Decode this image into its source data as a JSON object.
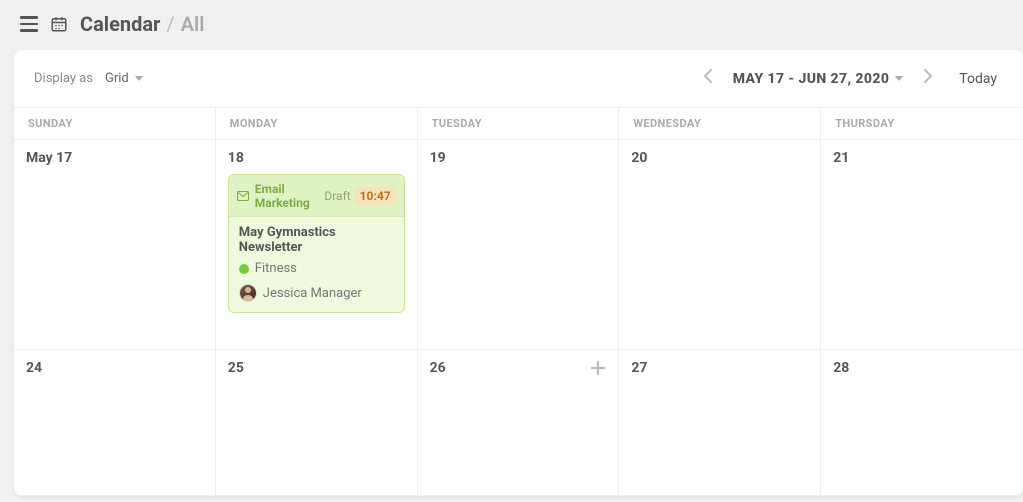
{
  "header": {
    "title": "Calendar",
    "subtitle": "All"
  },
  "toolbar": {
    "display_label": "Display as",
    "display_value": "Grid",
    "date_range": "MAY 17 - JUN 27, 2020",
    "today_label": "Today"
  },
  "weekdays": [
    "SUNDAY",
    "MONDAY",
    "TUESDAY",
    "WEDNESDAY",
    "THURSDAY"
  ],
  "rows": [
    {
      "days": [
        {
          "label": "May 17"
        },
        {
          "label": "18"
        },
        {
          "label": "19"
        },
        {
          "label": "20"
        },
        {
          "label": "21"
        }
      ]
    },
    {
      "days": [
        {
          "label": "24"
        },
        {
          "label": "25"
        },
        {
          "label": "26",
          "show_add": true
        },
        {
          "label": "27"
        },
        {
          "label": "28"
        }
      ]
    }
  ],
  "event": {
    "type_label": "Email Marketing",
    "status": "Draft",
    "time": "10:47",
    "title": "May Gymnastics Newsletter",
    "tag": "Fitness",
    "tag_color": "#6fcf3f",
    "user": "Jessica Manager"
  }
}
